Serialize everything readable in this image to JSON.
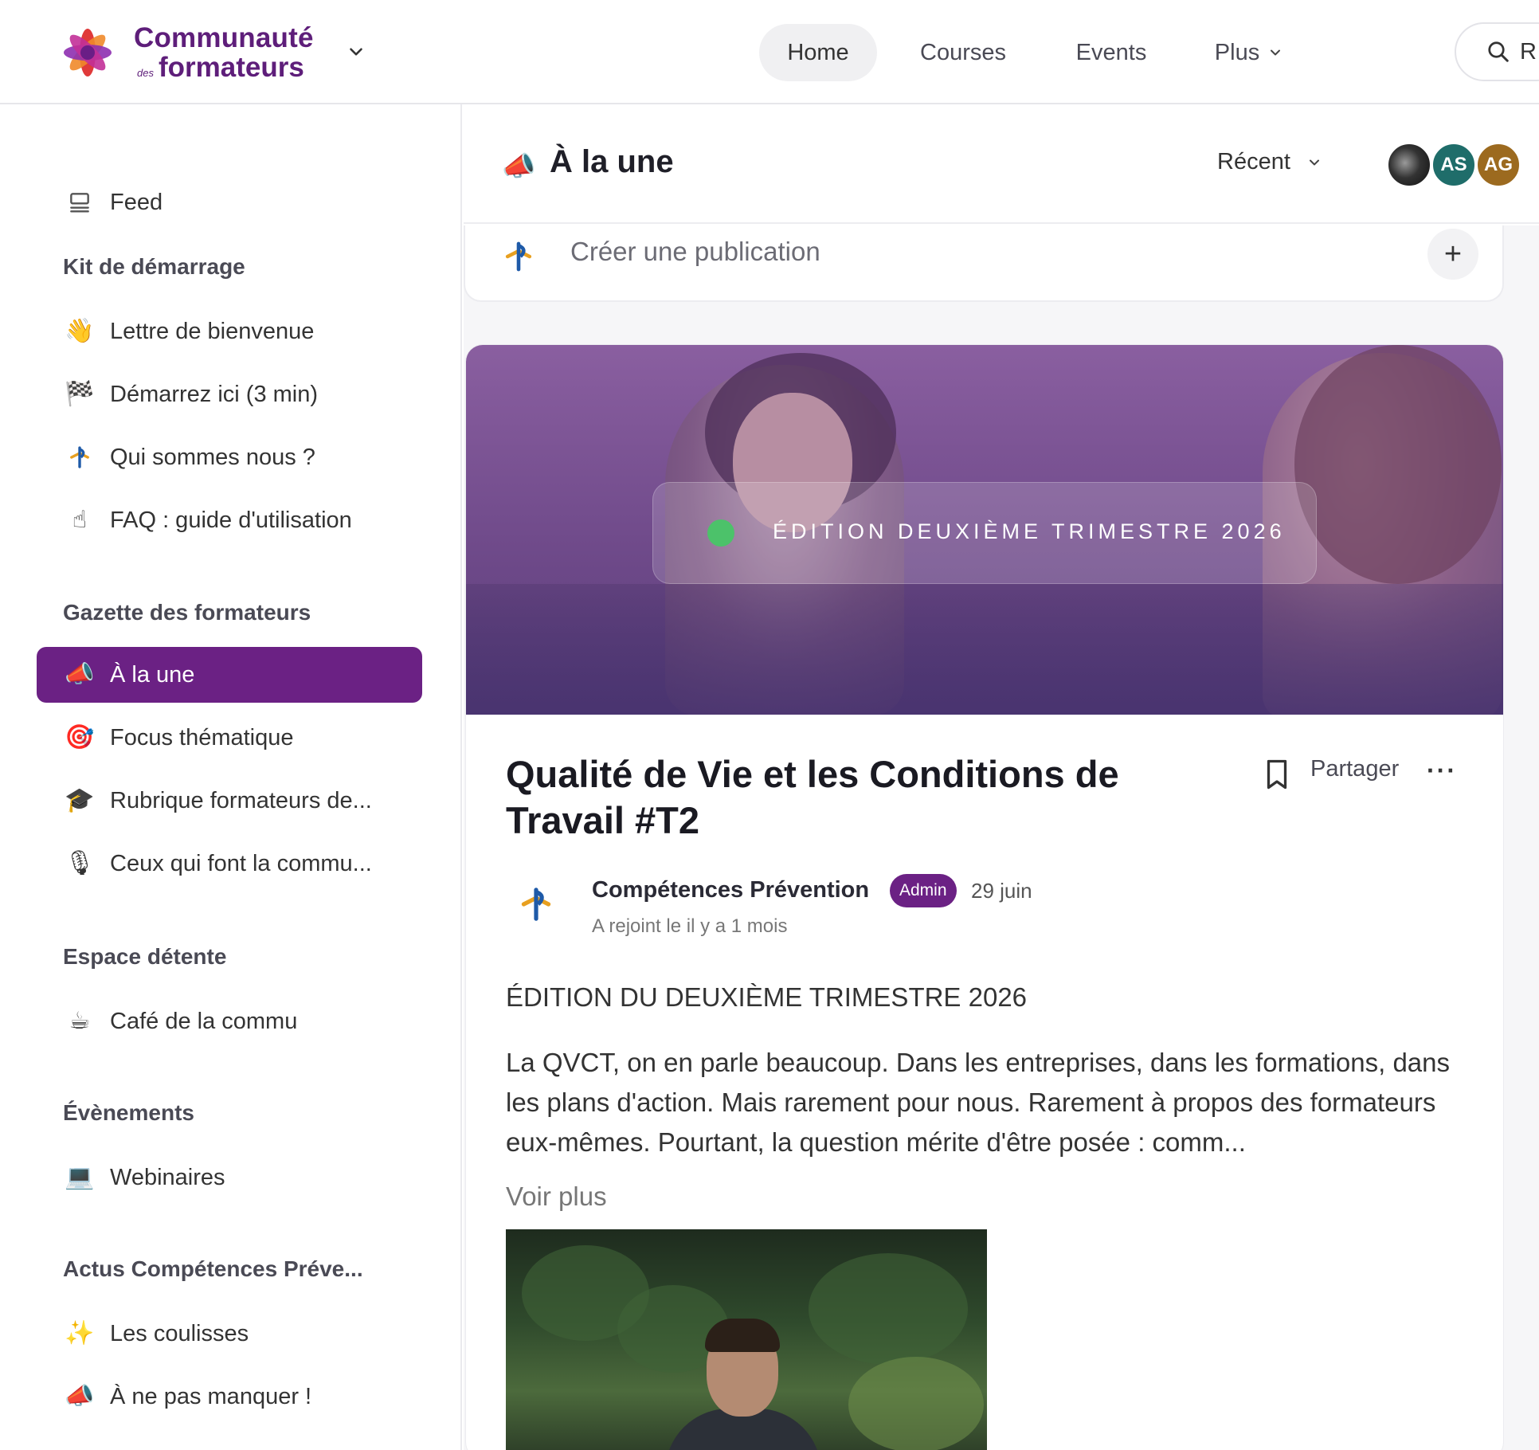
{
  "topbar": {
    "brand_line1": "Communauté",
    "brand_small": "des",
    "brand_line2": "formateurs",
    "nav": {
      "home": "Home",
      "courses": "Courses",
      "events": "Events",
      "plus": "Plus"
    },
    "search_text": "R"
  },
  "sidebar": {
    "feed": "Feed",
    "sections": [
      {
        "heading": "Kit de démarrage",
        "items": [
          {
            "icon": "👋",
            "label": "Lettre de bienvenue"
          },
          {
            "icon": "🏁",
            "label": "Démarrez ici (3 min)"
          },
          {
            "icon": "📌",
            "label": "Qui sommes nous ?"
          },
          {
            "icon": "☝",
            "label": "FAQ : guide d'utilisation"
          }
        ]
      },
      {
        "heading": "Gazette des formateurs",
        "items": [
          {
            "icon": "📣",
            "label": "À la une"
          },
          {
            "icon": "🎯",
            "label": "Focus thématique"
          },
          {
            "icon": "🎓",
            "label": "Rubrique formateurs de..."
          },
          {
            "icon": "🎙",
            "label": "Ceux qui font la commu..."
          }
        ]
      },
      {
        "heading": "Espace détente",
        "items": [
          {
            "icon": "☕",
            "label": "Café de la commu"
          }
        ]
      },
      {
        "heading": "Évènements",
        "items": [
          {
            "icon": "💻",
            "label": "Webinaires"
          }
        ]
      },
      {
        "heading": "Actus Compétences Préve...",
        "items": [
          {
            "icon": "✨",
            "label": "Les coulisses"
          },
          {
            "icon": "📣",
            "label": "À ne pas manquer !"
          }
        ]
      }
    ]
  },
  "main": {
    "header": {
      "icon": "📣",
      "title": "À la une",
      "sort_label": "Récent",
      "avatars": [
        {
          "initials": "",
          "color": "#333333"
        },
        {
          "initials": "AS",
          "color": "#1f6d6a"
        },
        {
          "initials": "AG",
          "color": "#9c6a1f"
        }
      ]
    },
    "composer": {
      "placeholder": "Créer une publication",
      "plus": "+"
    },
    "post": {
      "hero_banner_text": "ÉDITION DEUXIÈME TRIMESTRE 2026",
      "title": "Qualité de Vie et les Conditions de Travail #T2",
      "share_label": "Partager",
      "more": "···",
      "author": {
        "name": "Compétences Prévention",
        "badge": "Admin",
        "date": "29 juin",
        "joined": "A rejoint le il y a 1 mois"
      },
      "subtitle": "ÉDITION DU DEUXIÈME TRIMESTRE 2026",
      "body": "La QVCT, on en parle beaucoup. Dans les entreprises, dans les formations, dans les plans d'action. Mais rarement pour nous. Rarement à propos des formateurs eux-mêmes. Pourtant, la question mérite d'être posée : comm...",
      "see_more": "Voir plus"
    }
  },
  "colors": {
    "accent": "#6b2184",
    "brand": "#5e1e7a",
    "status_dot": "#4cc26a"
  }
}
